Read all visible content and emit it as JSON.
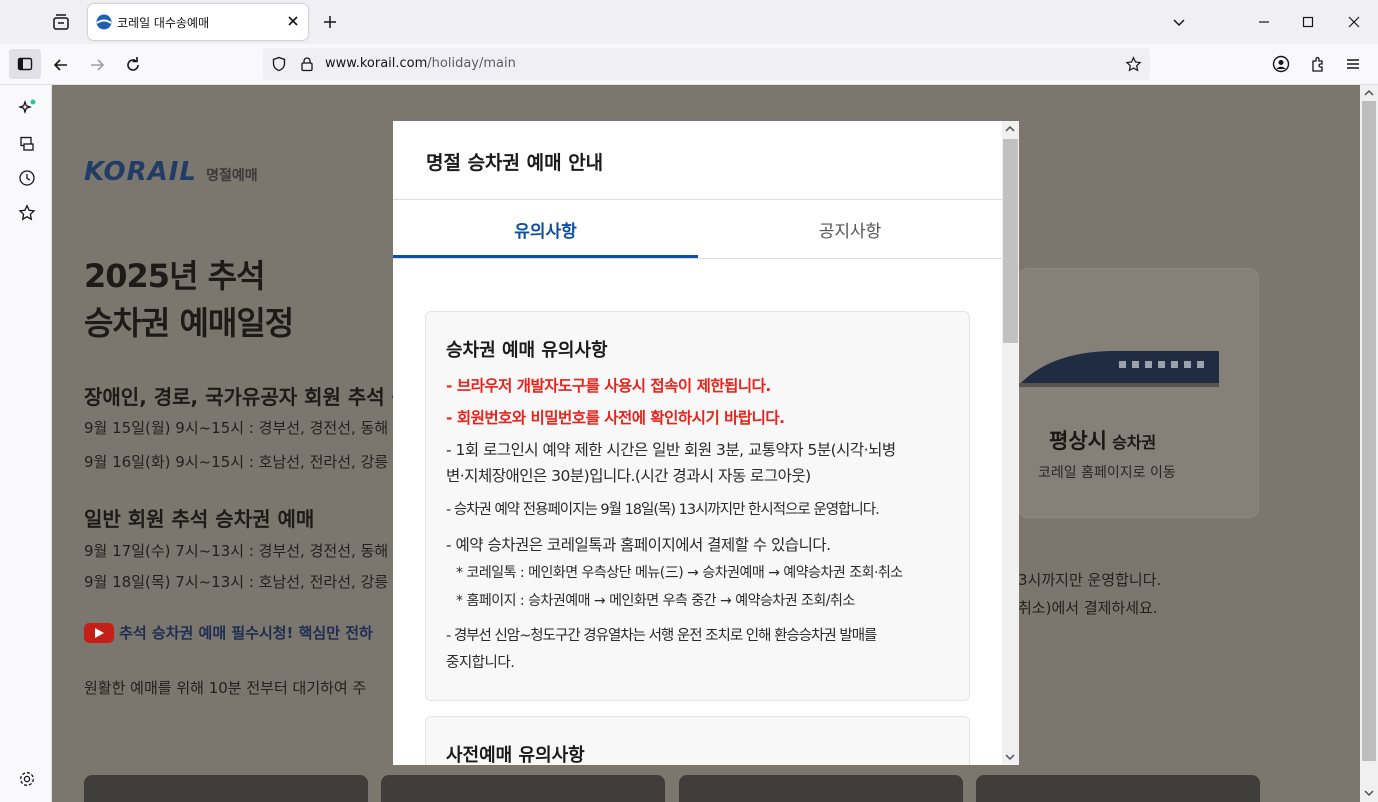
{
  "browser": {
    "tab_title": "코레일 대수송예매",
    "url_domain": "www.korail.com",
    "url_path": "/holiday/main"
  },
  "page": {
    "logo_text": "KORAIL",
    "logo_sub": "명절예매",
    "heading_line1": "2025년 추석",
    "heading_line2": "승차권 예매일정",
    "section1_title": "장애인, 경로, 국가유공자 회원 추석 승",
    "section1_lines": [
      "9월 15일(월) 9시~15시 : 경부선, 경전선, 동해",
      "9월 16일(화) 9시~15시 : 호남선, 전라선, 강릉"
    ],
    "section2_title": "일반 회원 추석 승차권 예매",
    "section2_lines": [
      "9월 17일(수) 7시~13시 : 경부선, 경전선, 동해",
      "9월 18일(목) 7시~13시 : 호남선, 전라선, 강릉"
    ],
    "youtube_text": "추석 승차권 예매 필수시청! 핵심만 전하",
    "wait_text": "원활한 예매를 위해 10분 전부터 대기하여 주",
    "right_card_title_bold": "평상시",
    "right_card_title": "승차권",
    "right_card_sub": "코레일 홈페이지로 이동",
    "right_text1": "3시까지만 운영합니다.",
    "right_text2": "취소)에서 결제하세요."
  },
  "modal": {
    "title": "명절 승차권 예매 안내",
    "tabs": [
      "유의사항",
      "공지사항"
    ],
    "active_tab_color": "#0d4fa0",
    "box1": {
      "title": "승차권 예매 유의사항",
      "red_lines": [
        "- 브라우저 개발자도구를 사용시 접속이 제한됩니다.",
        "- 회원번호와 비밀번호를 사전에 확인하시기 바랍니다."
      ],
      "lines": [
        "- 1회 로그인시 예약 제한 시간은 일반 회원 3분, 교통약자 5분(시각·뇌병",
        "  변·지체장애인은 30분)입니다.(시간 경과시 자동 로그아웃)",
        "- 승차권 예약 전용페이지는 9월 18일(목) 13시까지만 한시적으로 운영합니다.",
        "- 예약 승차권은 코레일톡과 홈페이지에서 결제할 수 있습니다.",
        "* 코레일톡 : 메인화면 우측상단 메뉴(三) → 승차권예매 → 예약승차권 조회·취소",
        "* 홈페이지 : 승차권예매 → 메인화면 우측 중간 → 예약승차권 조회/취소",
        "- 경부선 신암~청도구간 경유열차는 서행 운전 조치로 인해 환승승차권 발매를",
        "  중지합니다."
      ]
    },
    "box2": {
      "title": "사전예매 유의사항"
    }
  }
}
